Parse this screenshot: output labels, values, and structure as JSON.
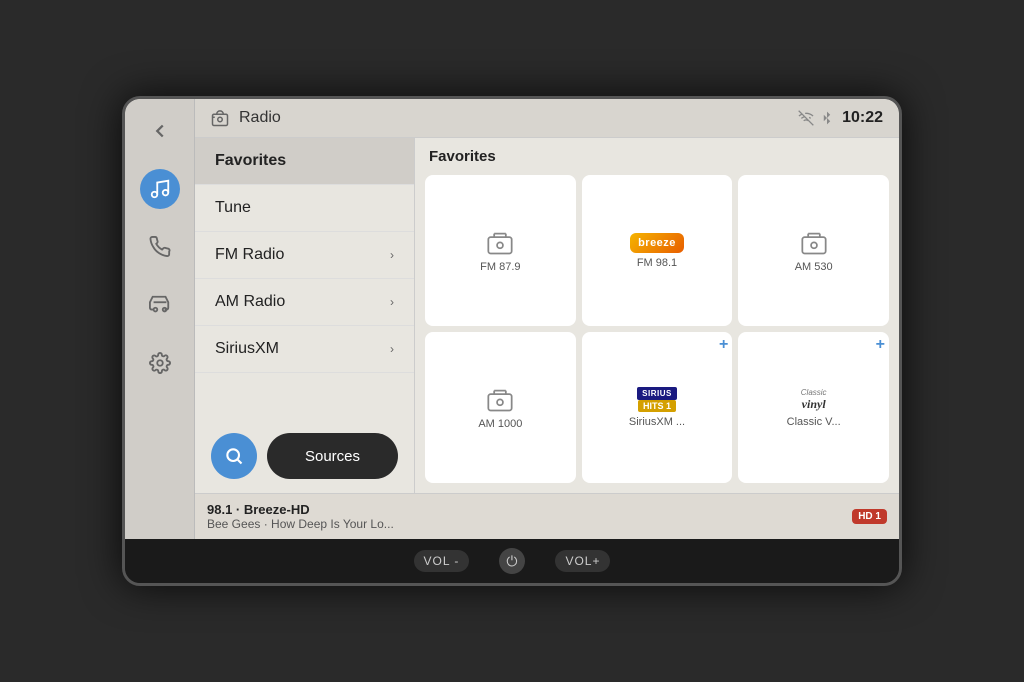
{
  "header": {
    "back_icon": "◀",
    "radio_icon": "📻",
    "title": "Radio",
    "no_signal_icon": "🔕",
    "bluetooth_icon": "⬡",
    "time": "10:22"
  },
  "sidebar": {
    "icons": [
      {
        "name": "back-arrow",
        "symbol": "◀",
        "active": false
      },
      {
        "name": "music-note",
        "symbol": "♪",
        "active": true
      },
      {
        "name": "phone",
        "symbol": "✆",
        "active": false
      },
      {
        "name": "car",
        "symbol": "🚗",
        "active": false
      },
      {
        "name": "settings",
        "symbol": "⚙",
        "active": false
      }
    ]
  },
  "menu": {
    "items": [
      {
        "label": "Favorites",
        "has_arrow": false,
        "selected": true
      },
      {
        "label": "Tune",
        "has_arrow": false,
        "selected": false
      },
      {
        "label": "FM Radio",
        "has_arrow": true,
        "selected": false
      },
      {
        "label": "AM Radio",
        "has_arrow": true,
        "selected": false
      },
      {
        "label": "SiriusXM",
        "has_arrow": true,
        "selected": false
      }
    ],
    "search_label": "Search",
    "sources_label": "Sources"
  },
  "favorites": {
    "title": "Favorites",
    "cards": [
      {
        "id": "fm879",
        "label": "FM 87.9",
        "type": "radio",
        "has_add": false
      },
      {
        "id": "fm981",
        "label": "FM 98.1",
        "type": "logo_fm981",
        "has_add": false
      },
      {
        "id": "am530",
        "label": "AM 530",
        "type": "radio",
        "has_add": false
      },
      {
        "id": "am1000",
        "label": "AM 1000",
        "type": "radio",
        "has_add": false
      },
      {
        "id": "siriusxm",
        "label": "SiriusXM ...",
        "type": "logo_sirius",
        "has_add": true
      },
      {
        "id": "classicv",
        "label": "Classic V...",
        "type": "logo_classic",
        "has_add": true
      }
    ]
  },
  "now_playing": {
    "station": "98.1 · Breeze-HD",
    "track": "Bee Gees · How Deep Is Your Lo...",
    "badge": "HD 1"
  },
  "bottom_controls": {
    "vol_minus": "VOL -",
    "power": "⏻",
    "vol_plus": "VOL+"
  }
}
